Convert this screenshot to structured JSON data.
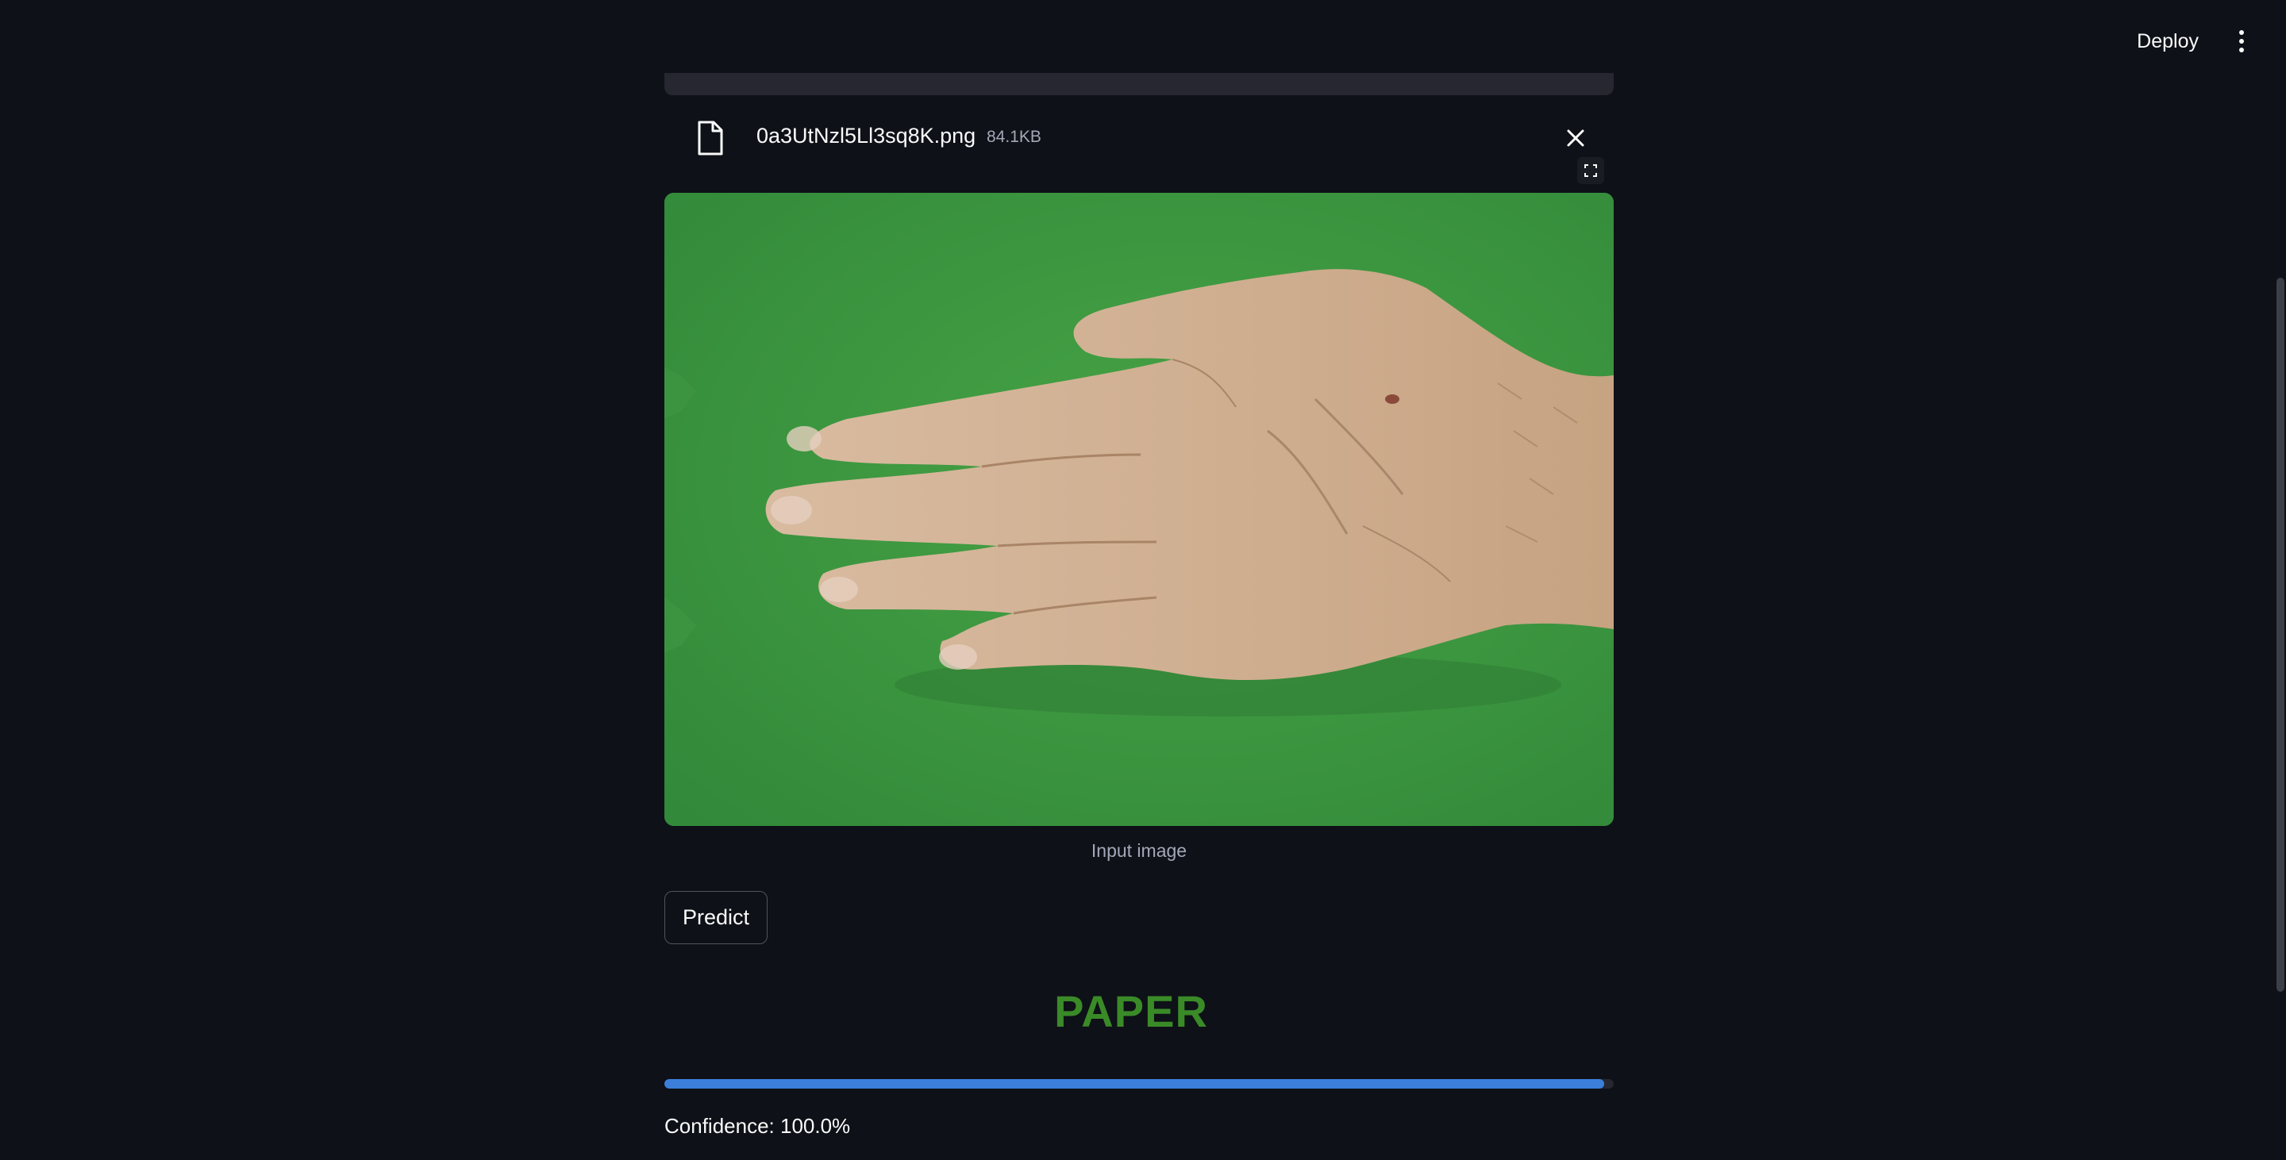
{
  "header": {
    "deploy_label": "Deploy",
    "menu_icon": "more-vertical-icon"
  },
  "uploader": {
    "file_icon": "file-icon",
    "file_name": "0a3UtNzl5Ll3sq8K.png",
    "file_size": "84.1KB",
    "close_icon": "close-icon"
  },
  "image": {
    "fullscreen_icon": "fullscreen-icon",
    "caption": "Input image"
  },
  "actions": {
    "predict_label": "Predict"
  },
  "result": {
    "label": "PAPER",
    "label_color": "#3a8a28",
    "confidence_fraction": 1.0,
    "confidence_text": "Confidence: 100.0%",
    "bar_color": "#3b7fdb"
  }
}
